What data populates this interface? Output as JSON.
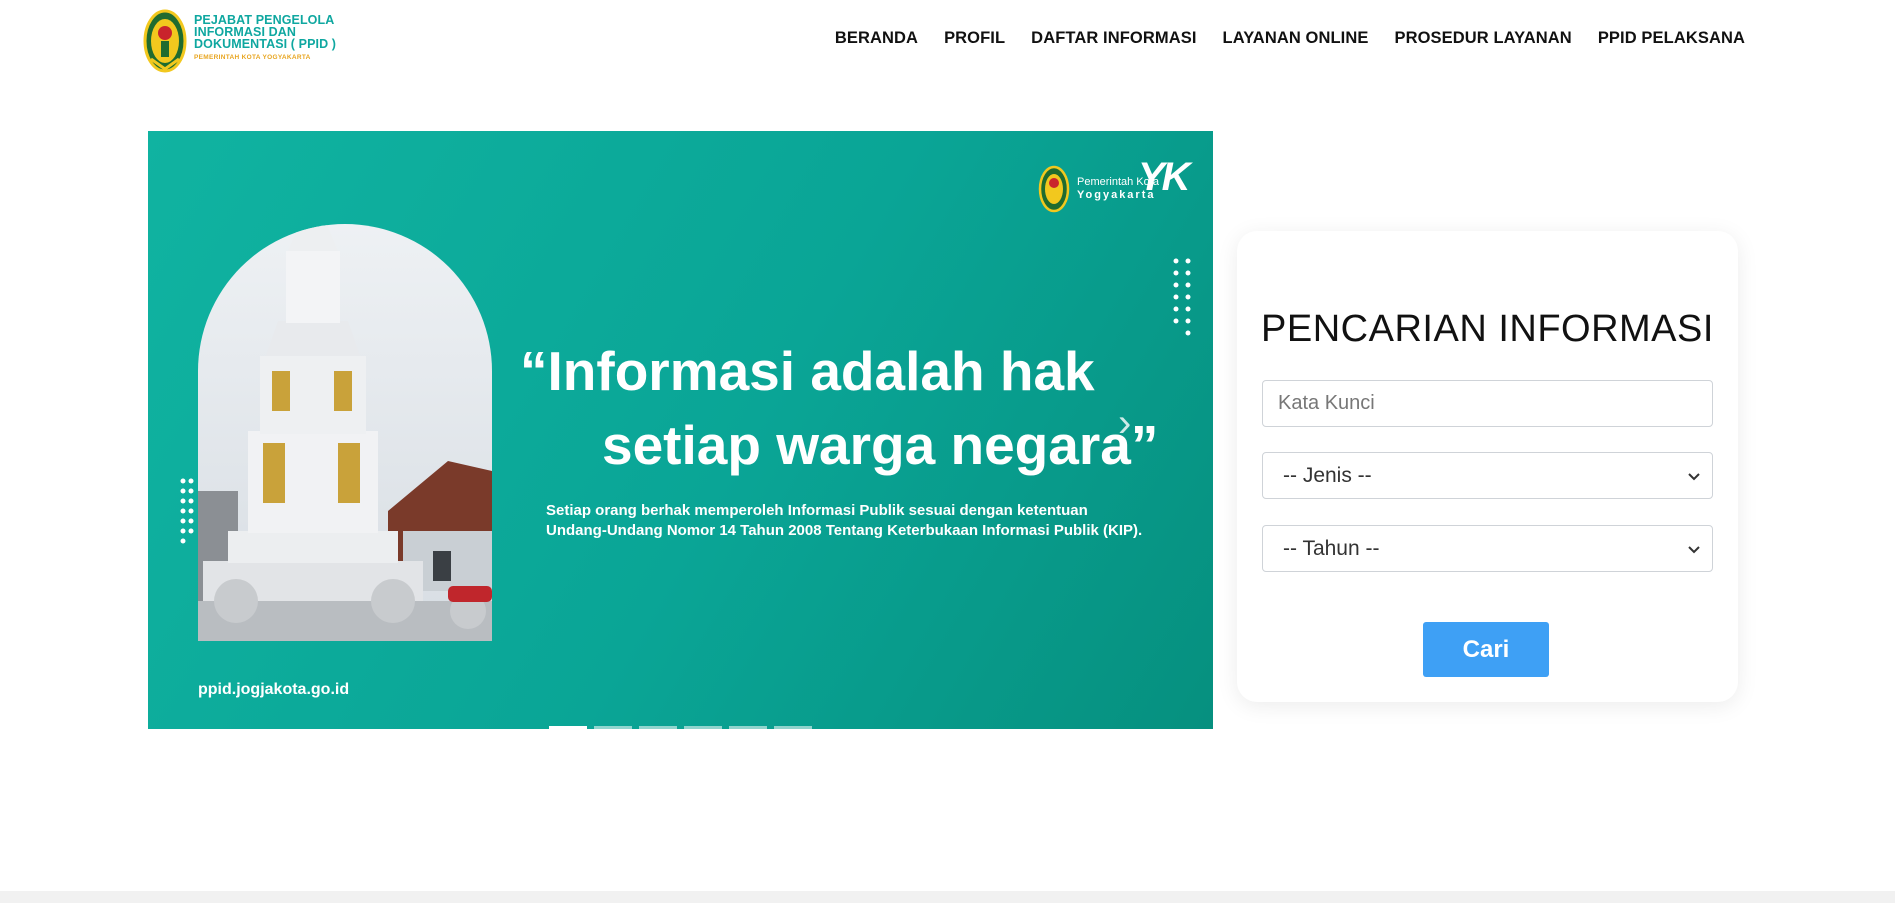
{
  "header": {
    "brand_title": "PEJABAT PENGELOLA INFORMASI DAN DOKUMENTASI ( PPID )",
    "brand_sub": "PEMERINTAH KOTA YOGYAKARTA",
    "nav": [
      "BERANDA",
      "PROFIL",
      "DAFTAR INFORMASI",
      "LAYANAN ONLINE",
      "PROSEDUR LAYANAN",
      "PPID PELAKSANA"
    ]
  },
  "slider": {
    "quote_line1": "“Informasi adalah hak",
    "quote_line2": "setiap warga negara”",
    "body_line1": "Setiap orang berhak memperoleh Informasi Publik sesuai dengan ketentuan",
    "body_line2": "Undang-Undang Nomor 14 Tahun 2008 Tentang Keterbukaan Informasi Publik (KIP).",
    "url": "ppid.jogjakota.go.id",
    "gov_line1": "Pemerintah Kota",
    "gov_line2": "Yogyakarta",
    "yk_logo": "YK",
    "next_icon": "›",
    "slide_count": 6,
    "active_slide": 1,
    "colors": {
      "bg": "#0aa596",
      "text": "#ffffff"
    }
  },
  "search": {
    "title": "PENCARIAN INFORMASI",
    "keyword_placeholder": "Kata Kunci",
    "jenis_selected": "-- Jenis --",
    "tahun_selected": "-- Tahun --",
    "submit_label": "Cari",
    "colors": {
      "button": "#3ea0f5"
    }
  }
}
